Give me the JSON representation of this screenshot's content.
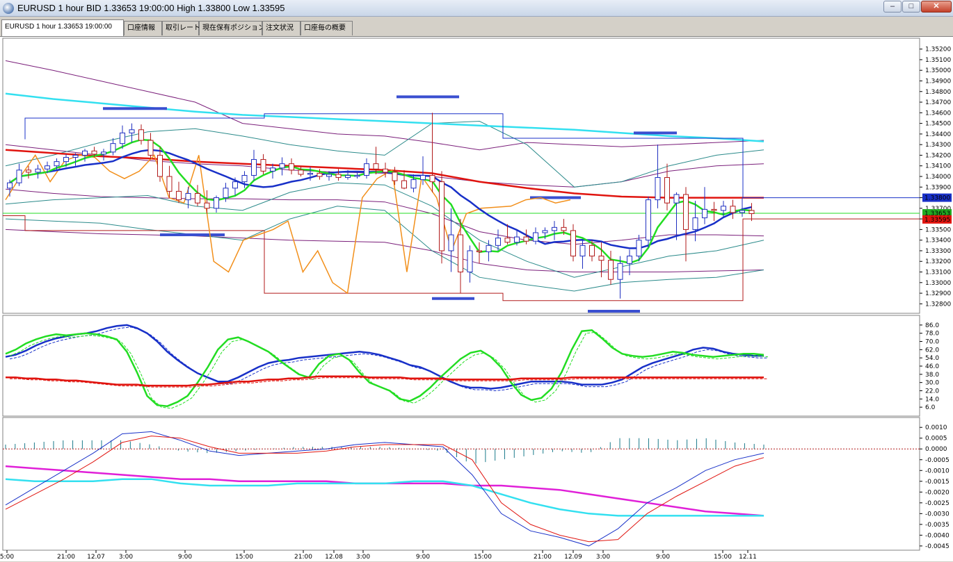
{
  "window": {
    "title": "EURUSD 1 hour BID 1.33653 19:00:00 High 1.33800 Low 1.33595",
    "minimize_label": "–",
    "maximize_label": "□",
    "close_label": "✕",
    "icon": "globe-icon"
  },
  "tabs": [
    {
      "label": "EURUSD 1 hour 1.33653 19:00:00"
    },
    {
      "label": "口座情報"
    },
    {
      "label": "取引レート"
    },
    {
      "label": "現在保有ポジション"
    },
    {
      "label": "注文状況"
    },
    {
      "label": "口座毎の概要"
    }
  ],
  "colors": {
    "candle_up": "#1f2fc0",
    "candle_down": "#b11a1a",
    "ma_red": "#e0140f",
    "ma_cyan": "#33e0f0",
    "ma_blue": "#1830c8",
    "ma_green": "#22dd22",
    "orange": "#f28f1a",
    "bands": "#2a8a8a",
    "purple": "#7a1e7a",
    "levels": "#3a4fd0",
    "magenta": "#e020d8"
  },
  "chart_data": [
    {
      "type": "candlestick",
      "symbol": "EURUSD",
      "timeframe": "1 hour",
      "ylim": [
        1.3275,
        1.3525
      ],
      "y_ticks": [
        "1.35200",
        "1.35100",
        "1.35000",
        "1.34900",
        "1.34800",
        "1.34700",
        "1.34600",
        "1.34500",
        "1.34400",
        "1.34300",
        "1.34200",
        "1.34100",
        "1.34000",
        "1.33900",
        "1.33800",
        "1.33700",
        "1.33600",
        "1.33500",
        "1.33400",
        "1.33300",
        "1.33200",
        "1.33100",
        "1.33000",
        "1.32900",
        "1.32800"
      ],
      "price_tags": [
        {
          "text": "1.33800",
          "value": 1.338,
          "color": "#1830c8"
        },
        {
          "text": "1.33653",
          "value": 1.33653,
          "color": "#22aa22"
        },
        {
          "text": "1.33595",
          "value": 1.33595,
          "color": "#e0140f"
        }
      ],
      "candles": [
        [
          1.3389,
          1.3397,
          1.3381,
          1.3394
        ],
        [
          1.3394,
          1.3412,
          1.3391,
          1.3406
        ],
        [
          1.3406,
          1.341,
          1.3398,
          1.3404
        ],
        [
          1.3404,
          1.3411,
          1.3398,
          1.3407
        ],
        [
          1.3407,
          1.3414,
          1.3403,
          1.341
        ],
        [
          1.341,
          1.3417,
          1.3405,
          1.3414
        ],
        [
          1.3414,
          1.3421,
          1.3409,
          1.3418
        ],
        [
          1.3418,
          1.3422,
          1.341,
          1.342
        ],
        [
          1.342,
          1.3426,
          1.3414,
          1.3424
        ],
        [
          1.3424,
          1.3428,
          1.3418,
          1.3421
        ],
        [
          1.3421,
          1.3426,
          1.3415,
          1.3423
        ],
        [
          1.3423,
          1.3436,
          1.342,
          1.3431
        ],
        [
          1.3431,
          1.3448,
          1.3426,
          1.3441
        ],
        [
          1.3441,
          1.345,
          1.3432,
          1.3444
        ],
        [
          1.3444,
          1.3449,
          1.343,
          1.3434
        ],
        [
          1.3434,
          1.3441,
          1.3416,
          1.342
        ],
        [
          1.342,
          1.3428,
          1.3395,
          1.34
        ],
        [
          1.34,
          1.341,
          1.338,
          1.3386
        ],
        [
          1.3386,
          1.3395,
          1.3375,
          1.3378
        ],
        [
          1.3378,
          1.339,
          1.337,
          1.3384
        ],
        [
          1.3384,
          1.3392,
          1.3372,
          1.3375
        ],
        [
          1.3375,
          1.3387,
          1.3365,
          1.337
        ],
        [
          1.337,
          1.3382,
          1.3366,
          1.338
        ],
        [
          1.338,
          1.3394,
          1.3376,
          1.3389
        ],
        [
          1.3389,
          1.3399,
          1.3382,
          1.3395
        ],
        [
          1.3395,
          1.3405,
          1.3389,
          1.3401
        ],
        [
          1.3401,
          1.3425,
          1.3396,
          1.3416
        ],
        [
          1.3416,
          1.3421,
          1.3402,
          1.3405
        ],
        [
          1.3405,
          1.3412,
          1.3398,
          1.3408
        ],
        [
          1.3408,
          1.3418,
          1.3401,
          1.3412
        ],
        [
          1.3412,
          1.3417,
          1.3402,
          1.3406
        ],
        [
          1.3406,
          1.341,
          1.34,
          1.3402
        ],
        [
          1.3402,
          1.3409,
          1.3396,
          1.3403
        ],
        [
          1.3403,
          1.3407,
          1.3397,
          1.34
        ],
        [
          1.34,
          1.3405,
          1.3396,
          1.3402
        ],
        [
          1.3402,
          1.3407,
          1.3396,
          1.3399
        ],
        [
          1.3399,
          1.3406,
          1.3397,
          1.3401
        ],
        [
          1.3401,
          1.3405,
          1.3398,
          1.3401
        ],
        [
          1.3401,
          1.3417,
          1.3398,
          1.3412
        ],
        [
          1.3412,
          1.3428,
          1.3402,
          1.3407
        ],
        [
          1.3407,
          1.3413,
          1.3399,
          1.3404
        ],
        [
          1.3404,
          1.3409,
          1.3392,
          1.3396
        ],
        [
          1.3396,
          1.3406,
          1.3388,
          1.3389
        ],
        [
          1.3389,
          1.3402,
          1.3385,
          1.3397
        ],
        [
          1.3397,
          1.3419,
          1.3392,
          1.3401
        ],
        [
          1.3401,
          1.346,
          1.3385,
          1.3395
        ],
        [
          1.3395,
          1.3405,
          1.3318,
          1.333
        ],
        [
          1.333,
          1.337,
          1.331,
          1.3345
        ],
        [
          1.3345,
          1.336,
          1.329,
          1.331
        ],
        [
          1.331,
          1.3335,
          1.33,
          1.333
        ],
        [
          1.333,
          1.3338,
          1.3318,
          1.3329
        ],
        [
          1.3329,
          1.334,
          1.332,
          1.3335
        ],
        [
          1.3335,
          1.335,
          1.333,
          1.3342
        ],
        [
          1.3342,
          1.3355,
          1.3336,
          1.3338
        ],
        [
          1.3338,
          1.335,
          1.3335,
          1.3343
        ],
        [
          1.3343,
          1.335,
          1.3336,
          1.3339
        ],
        [
          1.3339,
          1.3352,
          1.3336,
          1.3347
        ],
        [
          1.3347,
          1.3352,
          1.3341,
          1.3349
        ],
        [
          1.3349,
          1.3358,
          1.334,
          1.3352
        ],
        [
          1.3352,
          1.336,
          1.3345,
          1.3349
        ],
        [
          1.3349,
          1.3355,
          1.332,
          1.3325
        ],
        [
          1.3325,
          1.334,
          1.3313,
          1.3335
        ],
        [
          1.3335,
          1.334,
          1.332,
          1.3325
        ],
        [
          1.3325,
          1.3338,
          1.3305,
          1.3321
        ],
        [
          1.3321,
          1.333,
          1.3298,
          1.3303
        ],
        [
          1.3303,
          1.3325,
          1.3285,
          1.3318
        ],
        [
          1.3318,
          1.3331,
          1.3307,
          1.3325
        ],
        [
          1.3325,
          1.3345,
          1.332,
          1.334
        ],
        [
          1.334,
          1.3381,
          1.3333,
          1.3378
        ],
        [
          1.3378,
          1.343,
          1.337,
          1.3399
        ],
        [
          1.3399,
          1.3412,
          1.3368,
          1.3375
        ],
        [
          1.3375,
          1.3385,
          1.334,
          1.3383
        ],
        [
          1.3383,
          1.339,
          1.332,
          1.335
        ],
        [
          1.335,
          1.3377,
          1.3339,
          1.3361
        ],
        [
          1.3361,
          1.339,
          1.3355,
          1.3369
        ],
        [
          1.3369,
          1.3376,
          1.3358,
          1.3368
        ],
        [
          1.3368,
          1.3377,
          1.3362,
          1.3372
        ],
        [
          1.3372,
          1.3378,
          1.336,
          1.3366
        ],
        [
          1.3366,
          1.338,
          1.3362,
          1.3368
        ],
        [
          1.3368,
          1.3375,
          1.3358,
          1.3365
        ]
      ]
    },
    {
      "type": "line",
      "name": "oscillator-pane",
      "ylim": [
        0,
        92
      ],
      "y_ticks": [
        "86.0",
        "78.0",
        "70.0",
        "62.0",
        "54.0",
        "46.0",
        "38.0",
        "30.0",
        "22.0",
        "14.0",
        "6.0"
      ],
      "series": [
        {
          "color": "#1830c8",
          "values": [
            55,
            57,
            61,
            66,
            70,
            73,
            75,
            77,
            78,
            80,
            83,
            85,
            86,
            83,
            78,
            70,
            60,
            52,
            45,
            39,
            35,
            31,
            31,
            35,
            40,
            45,
            49,
            51,
            52,
            54,
            55,
            56,
            57,
            58,
            59,
            60,
            59,
            57,
            54,
            51,
            47,
            45,
            41,
            36,
            31,
            27,
            25,
            25,
            24,
            25,
            27,
            29,
            31,
            31,
            31,
            31,
            30,
            28,
            28,
            28,
            30,
            33,
            39,
            45,
            49,
            52,
            55,
            58,
            62,
            64,
            63,
            60,
            58,
            57,
            56,
            56
          ]
        },
        {
          "color": "#22dd22",
          "values": [
            58,
            62,
            68,
            72,
            75,
            77,
            76,
            77,
            78,
            77,
            75,
            72,
            60,
            40,
            17,
            8,
            7,
            11,
            17,
            30,
            45,
            62,
            72,
            74,
            70,
            65,
            60,
            52,
            45,
            38,
            35,
            48,
            56,
            58,
            52,
            40,
            30,
            26,
            22,
            14,
            12,
            17,
            25,
            35,
            44,
            53,
            59,
            61,
            55,
            45,
            30,
            18,
            13,
            15,
            24,
            40,
            62,
            80,
            81,
            73,
            64,
            58,
            56,
            55,
            56,
            58,
            60,
            59,
            57,
            56,
            55,
            56,
            57,
            58,
            58,
            57
          ]
        },
        {
          "color": "#e0140f",
          "values": [
            35,
            35,
            34,
            34,
            33,
            33,
            32,
            32,
            31,
            30,
            29,
            28,
            28,
            28,
            27,
            27,
            27,
            27,
            27,
            28,
            28,
            29,
            30,
            31,
            31,
            32,
            33,
            33,
            34,
            34,
            35,
            36,
            36,
            36,
            36,
            36,
            35,
            35,
            35,
            35,
            34,
            34,
            34,
            34,
            33,
            33,
            33,
            33,
            33,
            33,
            33,
            34,
            34,
            34,
            34,
            34,
            35,
            35,
            35,
            35,
            35,
            35,
            35,
            35,
            35,
            35,
            35,
            35,
            35,
            35,
            35,
            35,
            35,
            35,
            35,
            35
          ]
        }
      ]
    },
    {
      "type": "line",
      "name": "macd-pane",
      "ylim": [
        -0.0046,
        0.0012
      ],
      "y_ticks": [
        "0.0010",
        "0.0005",
        "0.0000",
        "-0.0005",
        "-0.0010",
        "-0.0015",
        "-0.0020",
        "-0.0025",
        "-0.0030",
        "-0.0035",
        "-0.0040",
        "-0.0045"
      ],
      "series": [
        {
          "color": "#e020d8",
          "values": [
            -0.0008,
            -0.0009,
            -0.001,
            -0.0011,
            -0.0012,
            -0.0013,
            -0.0014,
            -0.0014,
            -0.0015,
            -0.0015,
            -0.0015,
            -0.0015,
            -0.0016,
            -0.0016,
            -0.0016,
            -0.0016,
            -0.0017,
            -0.0017,
            -0.0018,
            -0.0019,
            -0.0021,
            -0.0023,
            -0.0025,
            -0.0027,
            -0.0029,
            -0.003,
            -0.0031
          ]
        },
        {
          "color": "#33e0f0",
          "values": [
            -0.0014,
            -0.0015,
            -0.0015,
            -0.0015,
            -0.0014,
            -0.0014,
            -0.0016,
            -0.0017,
            -0.0017,
            -0.0017,
            -0.0016,
            -0.0016,
            -0.0016,
            -0.0016,
            -0.0015,
            -0.0015,
            -0.0017,
            -0.0021,
            -0.0025,
            -0.0028,
            -0.003,
            -0.0031,
            -0.0031,
            -0.0031,
            -0.0031,
            -0.0031,
            -0.0031
          ]
        },
        {
          "color": "#1830c8",
          "values": [
            -0.0026,
            -0.0018,
            -0.001,
            -0.0002,
            0.0007,
            0.0008,
            0.0004,
            -0.0001,
            -0.0003,
            -0.0002,
            -0.0001,
            0.0,
            0.0002,
            0.0003,
            0.0002,
            0.0001,
            -0.0012,
            -0.003,
            -0.0038,
            -0.0041,
            -0.0045,
            -0.0037,
            -0.0025,
            -0.0018,
            -0.001,
            -0.0005,
            -0.0002
          ]
        },
        {
          "color": "#e0140f",
          "values": [
            -0.0028,
            -0.0021,
            -0.0014,
            -0.0006,
            0.0003,
            0.0006,
            0.0005,
            0.0001,
            -0.0002,
            -0.0002,
            -0.0002,
            -0.0001,
            0.0001,
            0.0002,
            0.0002,
            0.0002,
            -0.0005,
            -0.0025,
            -0.0035,
            -0.004,
            -0.0043,
            -0.0042,
            -0.003,
            -0.0022,
            -0.0015,
            -0.0008,
            -0.0004
          ]
        }
      ]
    }
  ],
  "x_axis": {
    "labels": [
      "5:00",
      "21:00",
      "12.07",
      "3:00",
      "9:00",
      "15:00",
      "21:00",
      "12.08",
      "3:00",
      "9:00",
      "15:00",
      "21:00",
      "12.09",
      "3:00",
      "9:00",
      "15:00",
      "12.11"
    ]
  }
}
